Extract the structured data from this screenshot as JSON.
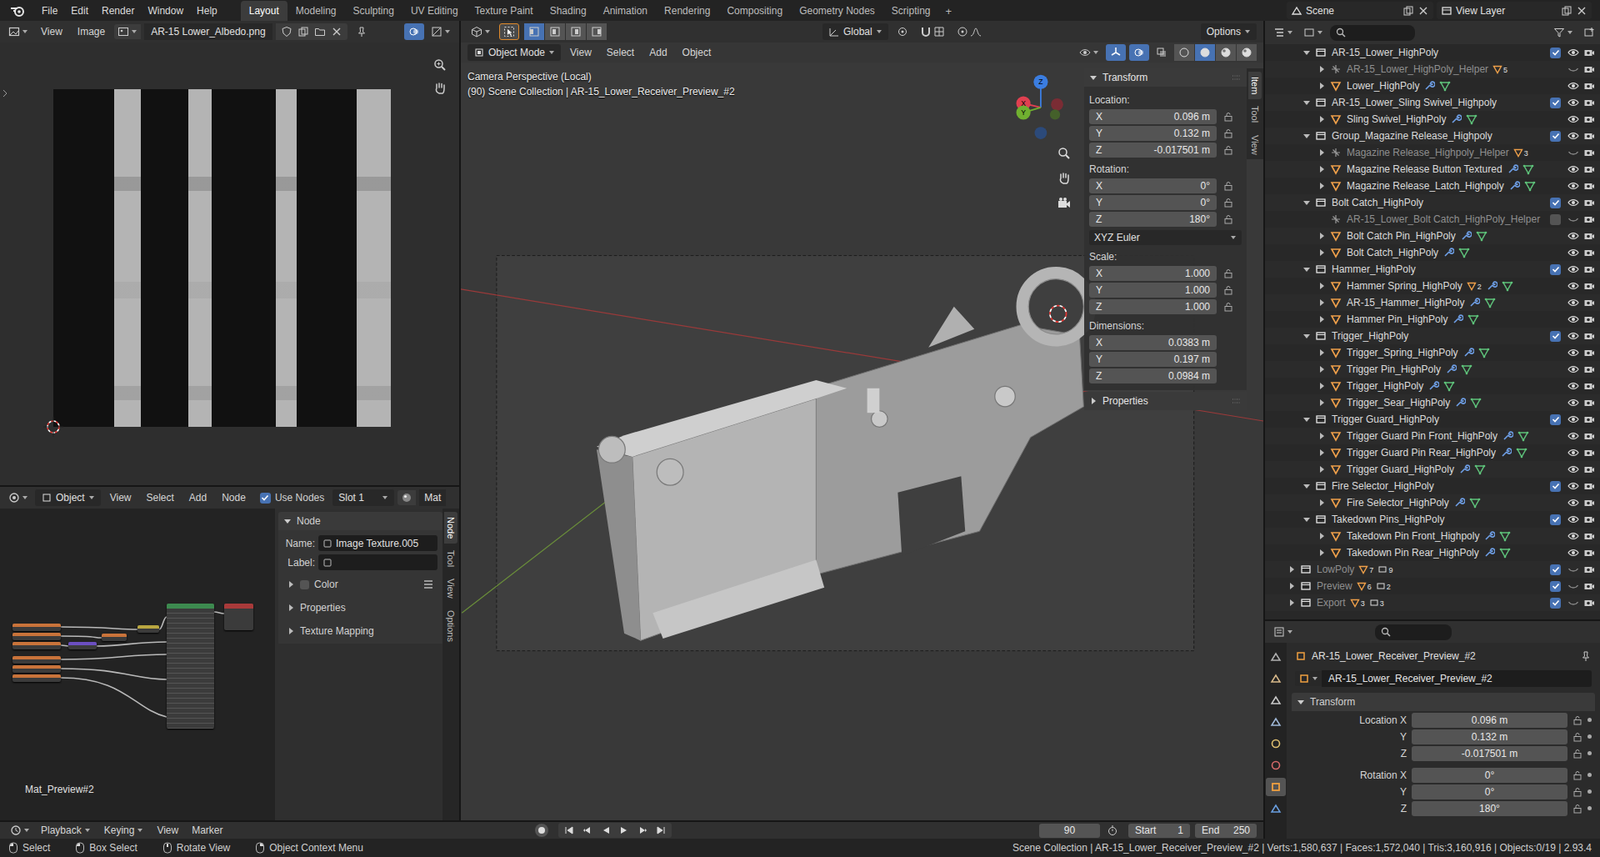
{
  "topbar": {
    "menus": [
      "File",
      "Edit",
      "Render",
      "Window",
      "Help"
    ],
    "workspaces": [
      {
        "label": "Layout",
        "selected": true
      },
      {
        "label": "Modeling",
        "selected": false
      },
      {
        "label": "Sculpting",
        "selected": false
      },
      {
        "label": "UV Editing",
        "selected": false
      },
      {
        "label": "Texture Paint",
        "selected": false
      },
      {
        "label": "Shading",
        "selected": false
      },
      {
        "label": "Animation",
        "selected": false
      },
      {
        "label": "Rendering",
        "selected": false
      },
      {
        "label": "Compositing",
        "selected": false
      },
      {
        "label": "Geometry Nodes",
        "selected": false
      },
      {
        "label": "Scripting",
        "selected": false
      }
    ],
    "add_workspace": "+",
    "scene": "Scene",
    "view_layer": "View Layer"
  },
  "image_editor": {
    "menus": [
      "View",
      "Image"
    ],
    "image_name": "AR-15 Lower_Albedo.png"
  },
  "node_editor": {
    "object_type": "Object",
    "menus": [
      "View",
      "Select",
      "Add",
      "Node"
    ],
    "use_nodes": {
      "label": "Use Nodes",
      "checked": true
    },
    "slot": "Slot 1",
    "material": "Mat",
    "material_name": "Mat_Preview#2",
    "sidebar": {
      "section": "Node",
      "fields": [
        {
          "label": "Name:",
          "value": "Image Texture.005"
        },
        {
          "label": "Label:",
          "value": ""
        }
      ],
      "panels": [
        {
          "label": "Color",
          "kind": "checkbox",
          "checked": false
        },
        {
          "label": "Properties",
          "kind": "plain"
        },
        {
          "label": "Texture Mapping",
          "kind": "plain"
        }
      ],
      "tabs": [
        {
          "label": "Node",
          "selected": true
        },
        {
          "label": "Tool",
          "selected": false
        },
        {
          "label": "View",
          "selected": false
        },
        {
          "label": "Options",
          "selected": false
        }
      ]
    }
  },
  "viewport": {
    "orientation": "Global",
    "options": "Options",
    "mode": "Object Mode",
    "menus": [
      "View",
      "Select",
      "Add",
      "Object"
    ],
    "overlay": [
      "Camera Perspective (Local)",
      "(90) Scene Collection | AR-15_Lower_Receiver_Preview_#2"
    ],
    "gizmo": {
      "x": "X",
      "y": "Y",
      "z": "Z"
    },
    "sidebar": {
      "section": "Transform",
      "groups": [
        {
          "label": "Location:",
          "lockable": true,
          "fields": [
            {
              "axis": "X",
              "value": "0.096 m"
            },
            {
              "axis": "Y",
              "value": "0.132 m"
            },
            {
              "axis": "Z",
              "value": "-0.017501 m"
            }
          ]
        },
        {
          "label": "Rotation:",
          "lockable": true,
          "fields": [
            {
              "axis": "X",
              "value": "0°"
            },
            {
              "axis": "Y",
              "value": "0°"
            },
            {
              "axis": "Z",
              "value": "180°"
            }
          ],
          "dropdown": "XYZ Euler"
        },
        {
          "label": "Scale:",
          "lockable": true,
          "fields": [
            {
              "axis": "X",
              "value": "1.000"
            },
            {
              "axis": "Y",
              "value": "1.000"
            },
            {
              "axis": "Z",
              "value": "1.000"
            }
          ]
        },
        {
          "label": "Dimensions:",
          "lockable": false,
          "fields": [
            {
              "axis": "X",
              "value": "0.0383 m"
            },
            {
              "axis": "Y",
              "value": "0.197 m"
            },
            {
              "axis": "Z",
              "value": "0.0984 m"
            }
          ]
        }
      ],
      "properties": "Properties",
      "tabs": [
        {
          "label": "Item",
          "selected": true
        },
        {
          "label": "Tool",
          "selected": false
        },
        {
          "label": "View",
          "selected": false
        }
      ]
    }
  },
  "outliner": {
    "rows": [
      {
        "name": "AR-15_Lower_HighPoly",
        "level": 1,
        "kind": "collection",
        "expanded": true,
        "visible": true,
        "checked": true
      },
      {
        "name": "AR-15_Lower_HighPoly_Helper",
        "level": 2,
        "kind": "helper",
        "expanded": false,
        "visible": false,
        "badges": [
          "5"
        ]
      },
      {
        "name": "Lower_HighPoly",
        "level": 2,
        "kind": "object",
        "expanded": false,
        "visible": true
      },
      {
        "name": "AR-15_Lower_Sling Swivel_Highpoly",
        "level": 1,
        "kind": "collection",
        "expanded": true,
        "visible": true,
        "checked": true
      },
      {
        "name": "Sling Swivel_HighPoly",
        "level": 2,
        "kind": "object",
        "expanded": false,
        "visible": true
      },
      {
        "name": "Group_Magazine Release_Highpoly",
        "level": 1,
        "kind": "collection",
        "expanded": true,
        "visible": true,
        "checked": true
      },
      {
        "name": "Magazine Release_Highpoly_Helper",
        "level": 2,
        "kind": "helper",
        "expanded": false,
        "visible": false,
        "badges": [
          "3"
        ]
      },
      {
        "name": "Magazine Release Button Textured",
        "level": 2,
        "kind": "object",
        "expanded": false,
        "visible": true
      },
      {
        "name": "Magazine Release_Latch_Highpoly",
        "level": 2,
        "kind": "object",
        "expanded": false,
        "visible": true
      },
      {
        "name": "Bolt Catch_HighPoly",
        "level": 1,
        "kind": "collection",
        "expanded": true,
        "visible": true,
        "checked": true
      },
      {
        "name": "AR-15_Lower_Bolt Catch_HighPoly_Helper",
        "level": 2,
        "kind": "helper",
        "visible": false,
        "checked": false
      },
      {
        "name": "Bolt Catch Pin_HighPoly",
        "level": 2,
        "kind": "object",
        "expanded": false,
        "visible": true
      },
      {
        "name": "Bolt Catch_HighPoly",
        "level": 2,
        "kind": "object",
        "expanded": false,
        "visible": true
      },
      {
        "name": "Hammer_HighPoly",
        "level": 1,
        "kind": "collection",
        "expanded": true,
        "visible": true,
        "checked": true
      },
      {
        "name": "Hammer Spring_HighPoly",
        "level": 2,
        "kind": "object",
        "expanded": false,
        "visible": true,
        "badges": [
          "2"
        ]
      },
      {
        "name": "AR-15_Hammer_HighPoly",
        "level": 2,
        "kind": "object",
        "expanded": false,
        "visible": true
      },
      {
        "name": "Hammer Pin_HighPoly",
        "level": 2,
        "kind": "object",
        "expanded": false,
        "visible": true
      },
      {
        "name": "Trigger_HighPoly",
        "level": 1,
        "kind": "collection",
        "expanded": true,
        "visible": true,
        "checked": true
      },
      {
        "name": "Trigger_Spring_HighPoly",
        "level": 2,
        "kind": "object",
        "expanded": false,
        "visible": true
      },
      {
        "name": "Trigger Pin_HighPoly",
        "level": 2,
        "kind": "object",
        "expanded": false,
        "visible": true
      },
      {
        "name": "Trigger_HighPoly",
        "level": 2,
        "kind": "object",
        "expanded": false,
        "visible": true
      },
      {
        "name": "Trigger_Sear_HighPoly",
        "level": 2,
        "kind": "object",
        "expanded": false,
        "visible": true
      },
      {
        "name": "Trigger Guard_HighPoly",
        "level": 1,
        "kind": "collection",
        "expanded": true,
        "visible": true,
        "checked": true
      },
      {
        "name": "Trigger Guard Pin Front_HighPoly",
        "level": 2,
        "kind": "object",
        "expanded": false,
        "visible": true
      },
      {
        "name": "Trigger Guard Pin Rear_HighPoly",
        "level": 2,
        "kind": "object",
        "expanded": false,
        "visible": true
      },
      {
        "name": "Trigger Guard_HighPoly",
        "level": 2,
        "kind": "object",
        "expanded": false,
        "visible": true
      },
      {
        "name": "Fire Selector_HighPoly",
        "level": 1,
        "kind": "collection",
        "expanded": true,
        "visible": true,
        "checked": true
      },
      {
        "name": "Fire Selector_HighPoly",
        "level": 2,
        "kind": "object",
        "expanded": false,
        "visible": true
      },
      {
        "name": "Takedown Pins_HighPoly",
        "level": 1,
        "kind": "collection",
        "expanded": true,
        "visible": true,
        "checked": true
      },
      {
        "name": "Takedown Pin Front_Highpoly",
        "level": 2,
        "kind": "object",
        "expanded": false,
        "visible": true
      },
      {
        "name": "Takedown Pin Rear_HighPoly",
        "level": 2,
        "kind": "object",
        "expanded": false,
        "visible": true
      },
      {
        "name": "LowPoly",
        "level": 0,
        "kind": "collection",
        "expanded": false,
        "visible": false,
        "checked": true,
        "badges": [
          "7",
          "9"
        ]
      },
      {
        "name": "Preview",
        "level": 0,
        "kind": "collection",
        "expanded": false,
        "visible": false,
        "checked": true,
        "badges": [
          "6",
          "2"
        ]
      },
      {
        "name": "Export",
        "level": 0,
        "kind": "collection",
        "expanded": false,
        "visible": false,
        "checked": true,
        "badges": [
          "3",
          "3"
        ]
      }
    ]
  },
  "properties": {
    "breadcrumb": "AR-15_Lower_Receiver_Preview_#2",
    "name": "AR-15_Lower_Receiver_Preview_#2",
    "panel": "Transform",
    "rows": [
      {
        "label": "Location X",
        "value": "0.096 m"
      },
      {
        "label": "Y",
        "value": "0.132 m"
      },
      {
        "label": "Z",
        "value": "-0.017501 m"
      },
      {
        "label": "Rotation X",
        "value": "0°"
      },
      {
        "label": "Y",
        "value": "0°"
      },
      {
        "label": "Z",
        "value": "180°"
      }
    ],
    "tabs": [
      {
        "kind": "tool",
        "selected": false
      },
      {
        "kind": "render",
        "selected": false
      },
      {
        "kind": "output",
        "selected": false
      },
      {
        "kind": "view_layer",
        "selected": false
      },
      {
        "kind": "scene",
        "selected": false
      },
      {
        "kind": "world",
        "selected": false
      },
      {
        "kind": "object",
        "selected": true
      },
      {
        "kind": "modifiers",
        "selected": false
      }
    ]
  },
  "timeline": {
    "menus": [
      {
        "label": "Playback",
        "dropdown": true
      },
      {
        "label": "Keying",
        "dropdown": true
      },
      {
        "label": "View",
        "dropdown": false
      },
      {
        "label": "Marker",
        "dropdown": false
      }
    ],
    "frame": "90",
    "start": {
      "label": "Start",
      "value": "1"
    },
    "end": {
      "label": "End",
      "value": "250"
    }
  },
  "status_bar": {
    "hints": [
      "Select",
      "Box Select",
      "Rotate View",
      "Object Context Menu"
    ],
    "info": "Scene Collection | AR-15_Lower_Receiver_Preview_#2 | Verts:1,580,637 | Faces:1,572,040 | Tris:3,160,916 | Objects:0/19 | 2.93.4"
  }
}
